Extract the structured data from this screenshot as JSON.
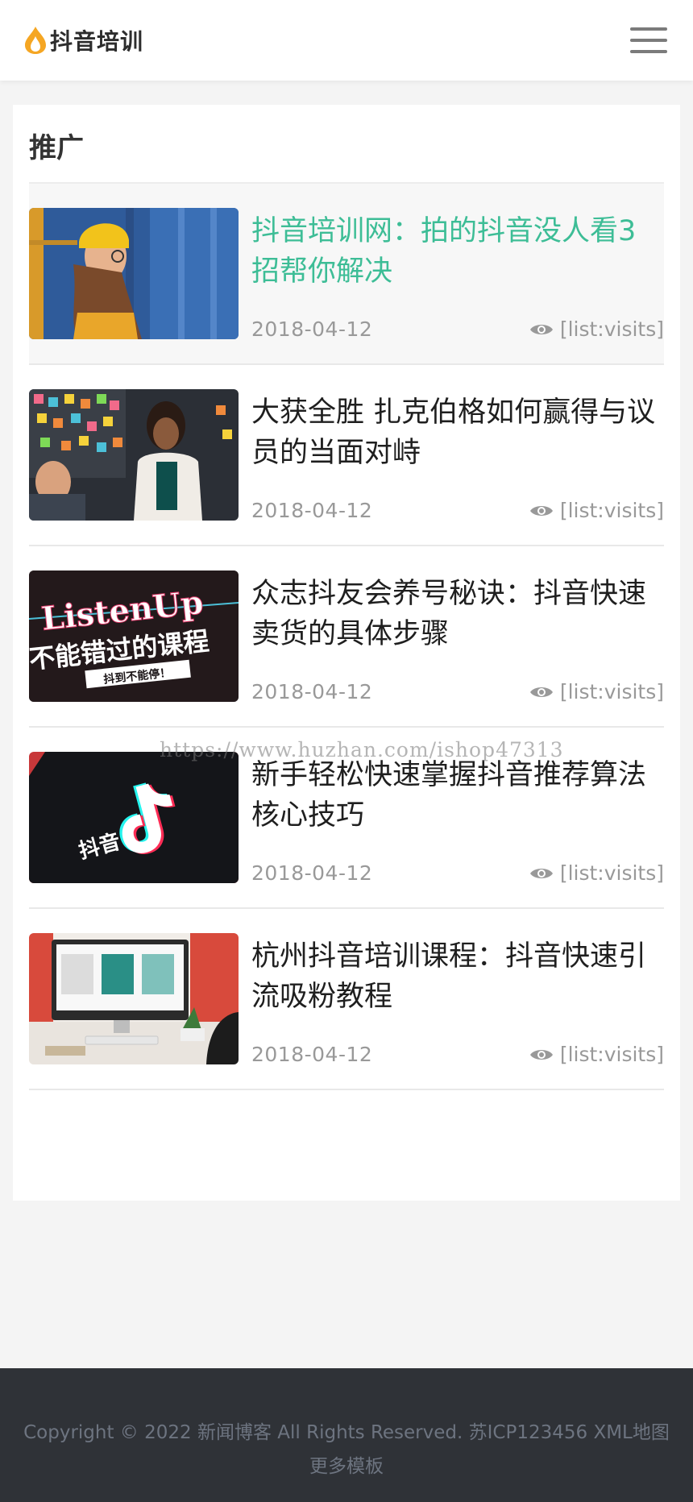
{
  "header": {
    "logo_text": "抖音培训",
    "logo_color": "#f5a623",
    "menu_icon": "hamburger-menu-icon"
  },
  "section": {
    "title": "推广"
  },
  "news": [
    {
      "title": "抖音培训网：拍的抖音没人看3招帮你解决",
      "date": "2018-04-12",
      "visits": "[list:visits]",
      "thumb_desc": "woman-yellow-beanie"
    },
    {
      "title": "大获全胜 扎克伯格如何赢得与议员的当面对峙",
      "date": "2018-04-12",
      "visits": "[list:visits]",
      "thumb_desc": "sticky-notes-meeting"
    },
    {
      "title": "众志抖友会养号秘诀：抖音快速卖货的具体步骤",
      "date": "2018-04-12",
      "visits": "[list:visits]",
      "thumb_desc": "listenup-course-banner",
      "thumb_text_1": "ListenUp",
      "thumb_text_2": "不能错过的课程",
      "thumb_text_3": "抖到不能停！"
    },
    {
      "title": "新手轻松快速掌握抖音推荐算法核心技巧",
      "date": "2018-04-12",
      "visits": "[list:visits]",
      "thumb_desc": "tiktok-logo-phone",
      "thumb_text_1": "抖音"
    },
    {
      "title": "杭州抖音培训课程：抖音快速引流吸粉教程",
      "date": "2018-04-12",
      "visits": "[list:visits]",
      "thumb_desc": "desk-imac"
    }
  ],
  "watermark": "https://www.huzhan.com/ishop47313",
  "footer": {
    "copyright": "Copyright © 2022 新闻博客 All Rights Reserved. 苏ICP123456 XML地图",
    "more": "更多模板"
  },
  "colors": {
    "accent": "#3dbd96",
    "footer_bg": "#2f3237",
    "page_bg": "#f4f4f4"
  }
}
